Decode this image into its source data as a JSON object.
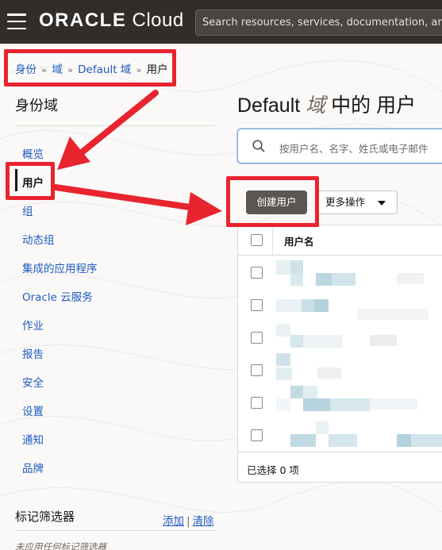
{
  "topbar": {
    "brand_bold": "ORACLE",
    "brand_light": "Cloud",
    "search_placeholder": "Search resources, services, documentation, and Marketplace"
  },
  "breadcrumb": {
    "items": [
      "身份",
      "域",
      "Default 域",
      "用户"
    ],
    "separator": "»"
  },
  "sidebar": {
    "title": "身份域",
    "items": [
      {
        "label": "概览"
      },
      {
        "label": "用户"
      },
      {
        "label": "组"
      },
      {
        "label": "动态组"
      },
      {
        "label": "集成的应用程序"
      },
      {
        "label": "Oracle 云服务"
      },
      {
        "label": "作业"
      },
      {
        "label": "报告"
      },
      {
        "label": "安全"
      },
      {
        "label": "设置"
      },
      {
        "label": "通知"
      },
      {
        "label": "品牌"
      }
    ],
    "active_index": 1,
    "tags": {
      "title": "标记筛选器",
      "add": "添加",
      "separator": "|",
      "clear": "清除",
      "note": "未应用任何标记筛选器"
    }
  },
  "main": {
    "title_prefix": "Default",
    "title_dim": "域",
    "title_suffix": "中的 用户",
    "search_placeholder": "按用户名、名字、姓氏或电子邮件",
    "create_button": "创建用户",
    "more_button": "更多操作",
    "table": {
      "header": "用户名",
      "row_count": 6,
      "footer": "已选择 0 项"
    }
  },
  "colors": {
    "topbar": "#312d2a",
    "link": "#1d5bbf",
    "annotation": "#e8242e",
    "primary_button": "#5b5652"
  },
  "icons": {
    "menu": "hamburger-icon",
    "search": "search-icon",
    "dropdown": "chevron-down-icon"
  }
}
